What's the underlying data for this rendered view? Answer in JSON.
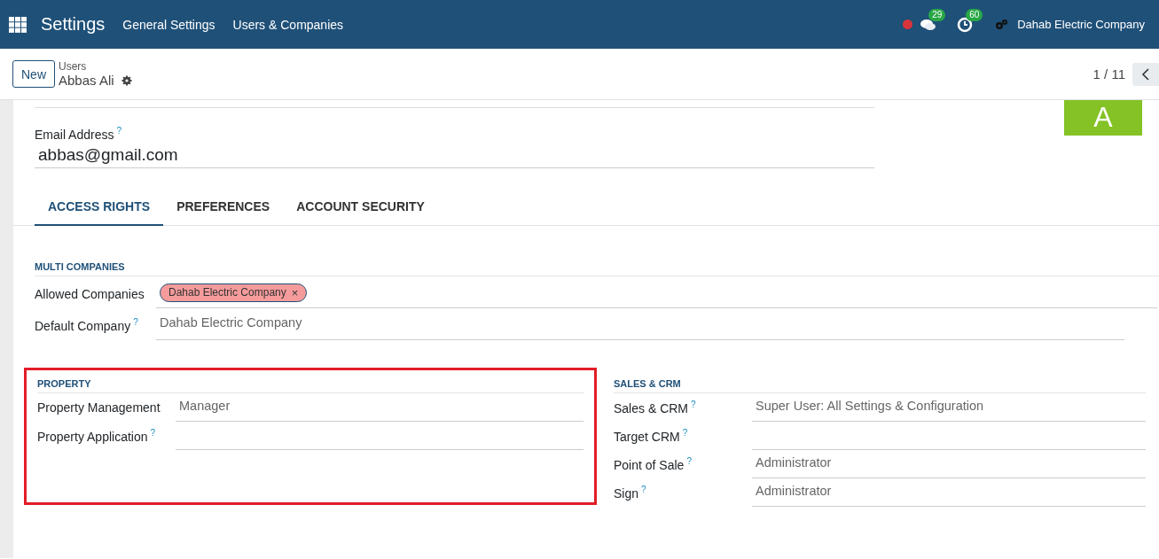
{
  "navbar": {
    "app_title": "Settings",
    "menu": [
      "General Settings",
      "Users & Companies"
    ],
    "messages_count": "29",
    "activities_count": "60",
    "company": "Dahab Electric Company"
  },
  "control_panel": {
    "new_button": "New",
    "breadcrumb_parent": "Users",
    "record_name": "Abbas Ali",
    "pager": "1 / 11"
  },
  "form": {
    "avatar_letter": "A",
    "email": {
      "label": "Email Address",
      "help_mark": "?",
      "value": "abbas@gmail.com"
    },
    "tabs": [
      {
        "label": "ACCESS RIGHTS",
        "selected": true
      },
      {
        "label": "PREFERENCES",
        "selected": false
      },
      {
        "label": "ACCOUNT SECURITY",
        "selected": false
      }
    ],
    "multi_companies": {
      "title": "MULTI COMPANIES",
      "allowed_label": "Allowed Companies",
      "allowed_tags": [
        "Dahab Electric Company"
      ],
      "tag_remove": "×",
      "default_label": "Default Company",
      "default_help": "?",
      "default_value": "Dahab Electric Company"
    },
    "groups": [
      {
        "title": "PROPERTY",
        "highlighted": true,
        "fields": [
          {
            "label": "Property Management",
            "value": "Manager"
          },
          {
            "label": "Property Application",
            "help_mark": "?"
          }
        ]
      },
      {
        "title": "SALES & CRM",
        "highlighted": false,
        "fields": [
          {
            "label": "Sales & CRM",
            "help_mark": "?",
            "value": "Super User: All Settings & Configuration"
          },
          {
            "label": "Target CRM",
            "help_mark": "?"
          },
          {
            "label": "Point of Sale",
            "help_mark": "?",
            "value": "Administrator"
          },
          {
            "label": "Sign",
            "help_mark": "?",
            "value": "Administrator"
          }
        ]
      }
    ]
  }
}
